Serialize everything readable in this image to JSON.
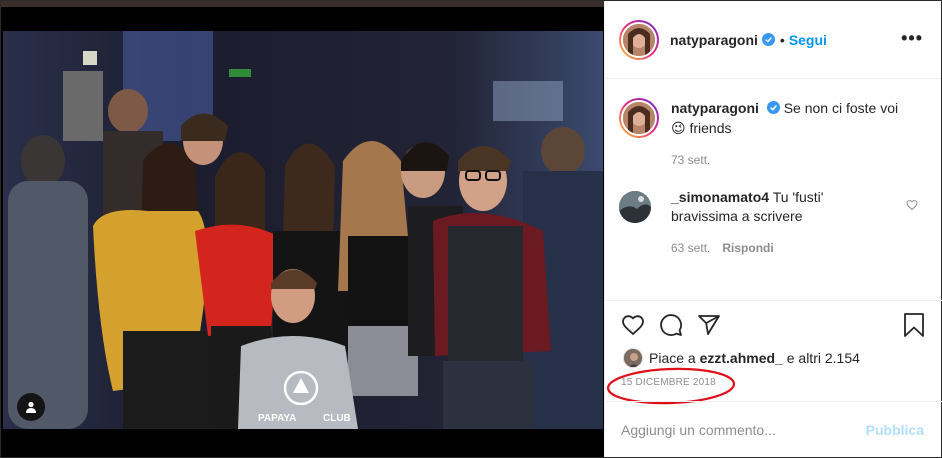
{
  "post": {
    "username": "natyparagoni",
    "follow_label": "Segui",
    "separator": "•",
    "more_label": "•••",
    "photo_watermark": "PAPAYA CLUB"
  },
  "caption": {
    "username": "natyparagoni",
    "text": "Se non ci foste voi 😉 friends",
    "time": "73 sett."
  },
  "comment": {
    "username": "_simonamato4",
    "text": "Tu 'fusti' bravissima a scrivere",
    "time": "63 sett.",
    "reply_label": "Rispondi"
  },
  "likes": {
    "prefix": "Piace a",
    "user": "ezzt.ahmed_",
    "suffix": "e altri 2.154"
  },
  "date": "15 DICEMBRE 2018",
  "add_comment": {
    "placeholder": "Aggiungi un commento...",
    "publish_label": "Pubblica"
  },
  "colors": {
    "accent": "#0095f6",
    "publish_disabled": "#b2dffc",
    "highlight": "#e0101a"
  },
  "icons": [
    "user-tag-icon",
    "verified-badge-icon",
    "more-options-icon",
    "heart-icon",
    "comment-icon",
    "share-icon",
    "bookmark-icon"
  ]
}
